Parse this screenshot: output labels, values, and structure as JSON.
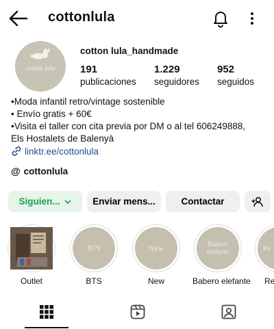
{
  "header": {
    "back_icon": "arrow-left-icon",
    "username": "cottonlula",
    "notify_icon": "bell-icon",
    "more_icon": "more-vertical-icon"
  },
  "profile": {
    "avatar_icon": "rabbit-logo",
    "avatar_text": "cotton lula",
    "name": "cotton lula_handmade",
    "stats": [
      {
        "value": "191",
        "label": "publicaciones"
      },
      {
        "value": "1.229",
        "label": "seguidores"
      },
      {
        "value": "952",
        "label": "seguidos"
      }
    ],
    "bio": [
      "•Moda infantil retro/vintage sostenible",
      "• Envío gratis + 60€",
      "•Visita el taller con cita previa por DM o al tel 606249888,",
      "Els Hostalets de Balenyà"
    ],
    "link": "linktr.ee/cottonlula",
    "threads_handle": "cottonlula"
  },
  "actions": {
    "follow_label": "Siguien...",
    "message_label": "Enviar mens...",
    "contact_label": "Contactar",
    "add_person_icon": "add-person-icon"
  },
  "highlights": [
    {
      "label": "Outlet",
      "cover_text": ""
    },
    {
      "label": "BTS",
      "cover_text": "BTS"
    },
    {
      "label": "New",
      "cover_text": "New"
    },
    {
      "label": "Babero elefante",
      "cover_text": "Babero elefante"
    },
    {
      "label": "Re",
      "cover_text": "Re"
    }
  ],
  "tabs": [
    {
      "icon": "grid-icon",
      "active": true
    },
    {
      "icon": "reels-icon",
      "active": false
    },
    {
      "icon": "tagged-icon",
      "active": false
    }
  ],
  "colors": {
    "follow_bg": "#e6f4ea",
    "follow_text": "#1b9e4b",
    "link": "#1d4b8f",
    "highlight_cover": "#c4bfae"
  }
}
